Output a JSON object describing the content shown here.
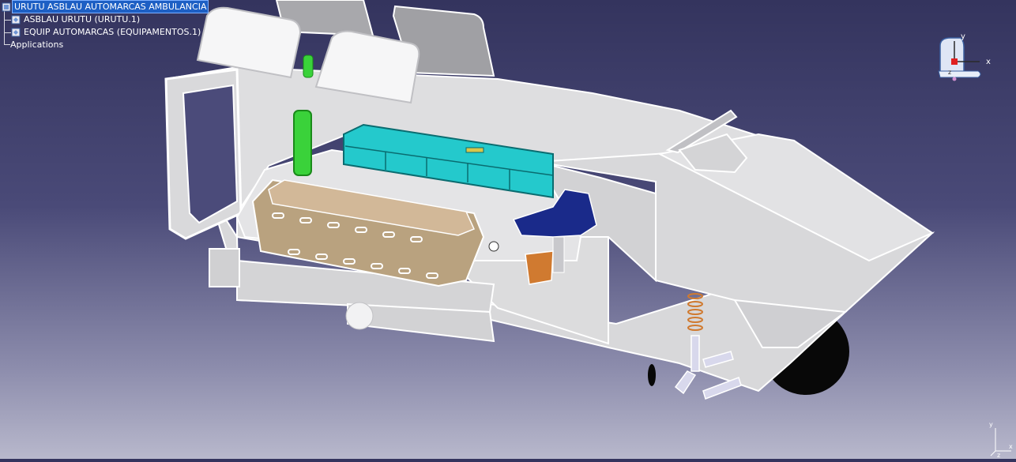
{
  "tree": {
    "root": {
      "label": "URUTU ASBLAU AUTOMARCAS AMBULANCIA",
      "selected": true
    },
    "children": [
      {
        "label": "ASBLAU URUTU (URUTU.1)"
      },
      {
        "label": "EQUIP AUTOMARCAS (EQUIPAMENTOS.1)"
      }
    ],
    "applications": {
      "label": "Applications"
    }
  },
  "compass": {
    "y_label": "y",
    "x_label": "x",
    "z_label": "z"
  },
  "axis": {
    "y_label": "y",
    "x_label": "x",
    "z_label": "z"
  },
  "colors": {
    "background_top": "#34345e",
    "background_bottom": "#b8b8cc",
    "hull": "#d7d7d9",
    "hull_edge": "#ffffff",
    "selection": "#1d5fc4",
    "cabinet": "#24c9cc",
    "stretcher": "#c4aa88",
    "oxygen_tank": "#3ad23a",
    "seat": "#1a2a8a",
    "container": "#d07a30",
    "wheel": "#0a0a0a"
  }
}
